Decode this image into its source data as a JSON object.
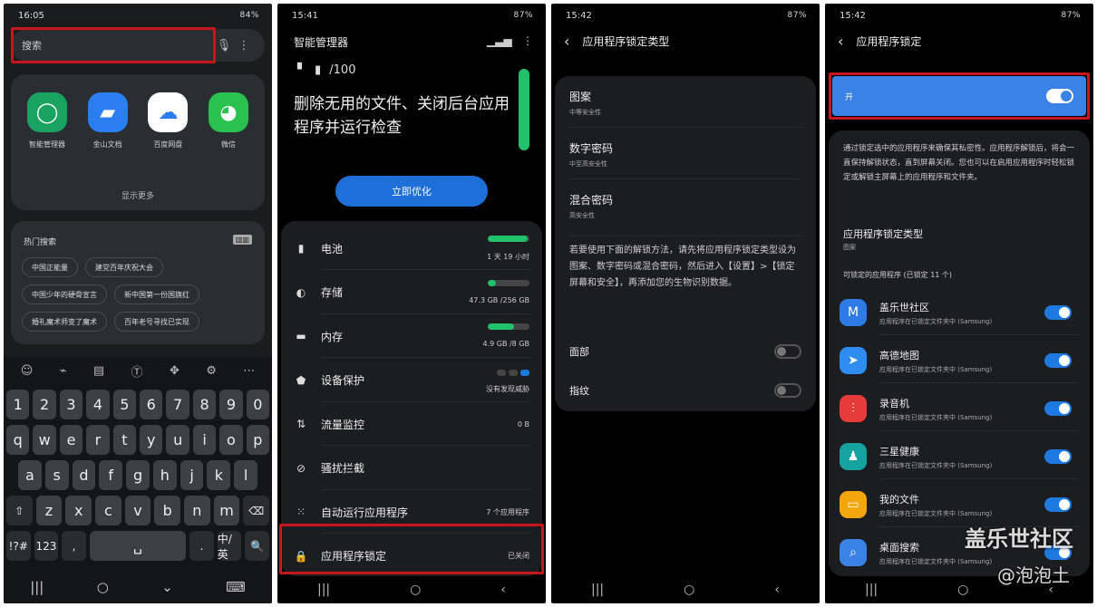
{
  "colors": {
    "accent": "#1f7ae0",
    "highlight": "#c8161e",
    "green": "#21c06a",
    "master_toggle_bg": "#3b82e6"
  },
  "phone1": {
    "status": {
      "time": "16:05",
      "right": "84%"
    },
    "search": {
      "placeholder": "搜索",
      "mic_icon": "mic-icon",
      "more_icon": "more-vertical-icon"
    },
    "apps": [
      {
        "label": "智能管理器",
        "color": "#1aa260",
        "glyph": "◯"
      },
      {
        "label": "金山文档",
        "color": "#2b7ef0",
        "glyph": "▰"
      },
      {
        "label": "百度网盘",
        "color": "#ffffff",
        "glyph": "☁"
      },
      {
        "label": "微信",
        "color": "#2ac14e",
        "glyph": "◕"
      }
    ],
    "show_more": "显示更多",
    "hot": {
      "title": "热门搜索",
      "chips": [
        "中国正能量",
        "建党百年庆祝大会",
        "中国少年的硬骨宣言",
        "新中国第一份国旗红",
        "婚礼魔术师变了魔术",
        "百年老号寻找已实现"
      ]
    },
    "keyboard": {
      "toolbar": [
        "☺",
        "⌁",
        "▤",
        "Ⓣ",
        "✥",
        "⚙",
        "⋯"
      ],
      "row1": [
        "1",
        "2",
        "3",
        "4",
        "5",
        "6",
        "7",
        "8",
        "9",
        "0"
      ],
      "row2": [
        "q",
        "w",
        "e",
        "r",
        "t",
        "y",
        "u",
        "i",
        "o",
        "p"
      ],
      "row3": [
        "a",
        "s",
        "d",
        "f",
        "g",
        "h",
        "j",
        "k",
        "l"
      ],
      "row4": [
        "⇧",
        "z",
        "x",
        "c",
        "v",
        "b",
        "n",
        "m",
        "⌫"
      ],
      "row5": [
        "!?#",
        "123",
        ",",
        "␣",
        ".",
        "中/英",
        "🔍"
      ],
      "nav": [
        "|||",
        "○",
        "⌄",
        "⌨"
      ]
    }
  },
  "phone2": {
    "status": {
      "time": "15:41",
      "right": "87%"
    },
    "title": "智能管理器",
    "score": "/100",
    "headline": "删除无用的文件、关闭后台应用程序并运行检查",
    "button": "立即优化",
    "rows": [
      {
        "icon": "▮",
        "label": "电池",
        "value": "1 天 19 小时",
        "fill": 0.95
      },
      {
        "icon": "◐",
        "label": "存储",
        "value": "47.3 GB /256 GB",
        "fill": 0.2
      },
      {
        "icon": "▬",
        "label": "内存",
        "value": "4.9 GB /8 GB",
        "fill": 0.62
      },
      {
        "icon": "⬟",
        "label": "设备保护",
        "value": "没有发现威胁"
      },
      {
        "icon": "⇅",
        "label": "流量监控",
        "value": "0 B"
      },
      {
        "icon": "⊘",
        "label": "骚扰拦截",
        "value": ""
      },
      {
        "icon": "⁙",
        "label": "自动运行应用程序",
        "value": "7 个应用程序"
      },
      {
        "icon": "🔒",
        "label": "应用程序锁定",
        "value": "已关闭"
      }
    ],
    "nav": [
      "|||",
      "○",
      "‹"
    ]
  },
  "phone3": {
    "status": {
      "time": "15:42",
      "right": "87%"
    },
    "title": "应用程序锁定类型",
    "options": [
      {
        "title": "图案",
        "sub": "中等安全性"
      },
      {
        "title": "数字密码",
        "sub": "中至高安全性"
      },
      {
        "title": "混合密码",
        "sub": "高安全性"
      }
    ],
    "description": "若要使用下面的解锁方法，请先将应用程序锁定类型设为图案、数字密码或混合密码，然后进入【设置】>【锁定屏幕和安全】，再添加您的生物识别数据。",
    "toggles": [
      {
        "label": "面部"
      },
      {
        "label": "指纹"
      }
    ],
    "nav": [
      "|||",
      "○",
      "‹"
    ]
  },
  "phone4": {
    "status": {
      "time": "15:42",
      "right": "87%"
    },
    "title": "应用程序锁定",
    "master_label": "开",
    "description": "通过锁定选中的应用程序来确保其私密性。应用程序解锁后，将会一直保持解锁状态，直到屏幕关闭。您也可以在启用应用程序时轻松锁定或解锁主屏幕上的应用程序和文件夹。",
    "type_title": "应用程序锁定类型",
    "type_value": "图案",
    "list_head": "可锁定的应用程序 (已锁定 11 个)",
    "apps": [
      {
        "name": "盖乐世社区",
        "desc": "应用程序在已锁定文件夹中 (Samsung)",
        "color": "#2e7be6",
        "glyph": "M"
      },
      {
        "name": "高德地图",
        "desc": "应用程序在已锁定文件夹中 (Samsung)",
        "color": "#2f8cf0",
        "glyph": "➤"
      },
      {
        "name": "录音机",
        "desc": "应用程序在已锁定文件夹中 (Samsung)",
        "color": "#e53b3b",
        "glyph": "⫶"
      },
      {
        "name": "三星健康",
        "desc": "应用程序在已锁定文件夹中 (Samsung)",
        "color": "#16a3a0",
        "glyph": "♟"
      },
      {
        "name": "我的文件",
        "desc": "应用程序在已锁定文件夹中 (Samsung)",
        "color": "#f2a60b",
        "glyph": "▭"
      },
      {
        "name": "桌面搜索",
        "desc": "应用程序在已锁定文件夹中 (Samsung)",
        "color": "#3b82e6",
        "glyph": "⌕"
      }
    ],
    "nav": [
      "|||",
      "○",
      "‹"
    ]
  },
  "watermark": {
    "line1": "盖乐世社区",
    "line2": "@泡泡土"
  }
}
